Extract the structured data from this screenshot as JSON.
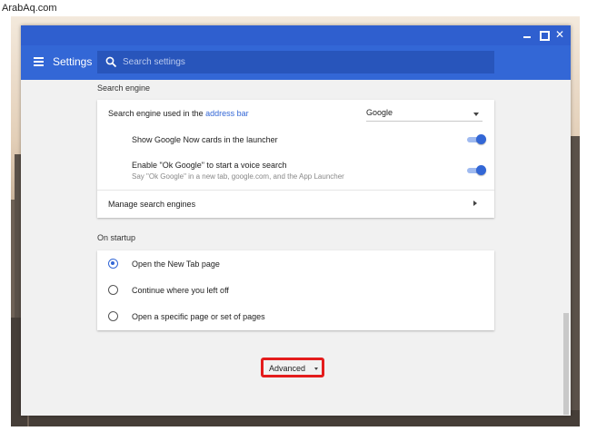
{
  "watermark": "ArabAq.com",
  "app": {
    "title": "Settings"
  },
  "search": {
    "placeholder": "Search settings",
    "value": ""
  },
  "window_controls": {
    "minimize": "–",
    "maximize": "□",
    "close": "✕"
  },
  "search_engine": {
    "section_title": "Search engine",
    "engine_row": {
      "label_prefix": "Search engine used in the ",
      "link_text": "address bar",
      "selected": "Google"
    },
    "google_now": {
      "label": "Show Google Now cards in the launcher",
      "enabled": true
    },
    "ok_google": {
      "label": "Enable \"Ok Google\" to start a voice search",
      "sublabel": "Say \"Ok Google\" in a new tab, google.com, and the App Launcher",
      "enabled": true
    },
    "manage": {
      "label": "Manage search engines"
    }
  },
  "startup": {
    "section_title": "On startup",
    "options": [
      {
        "label": "Open the New Tab page",
        "checked": true
      },
      {
        "label": "Continue where you left off",
        "checked": false
      },
      {
        "label": "Open a specific page or set of pages",
        "checked": false
      }
    ]
  },
  "advanced": {
    "label": "Advanced"
  },
  "colors": {
    "titlebar": "#2f5fcf",
    "toolbar": "#3367d6",
    "accent": "#3367d6",
    "highlight": "#e41c1c"
  },
  "icons": {
    "menu": "hamburger-menu-icon",
    "search": "search-icon",
    "dropdown": "caret-down-icon",
    "manage": "chevron-right-icon"
  }
}
